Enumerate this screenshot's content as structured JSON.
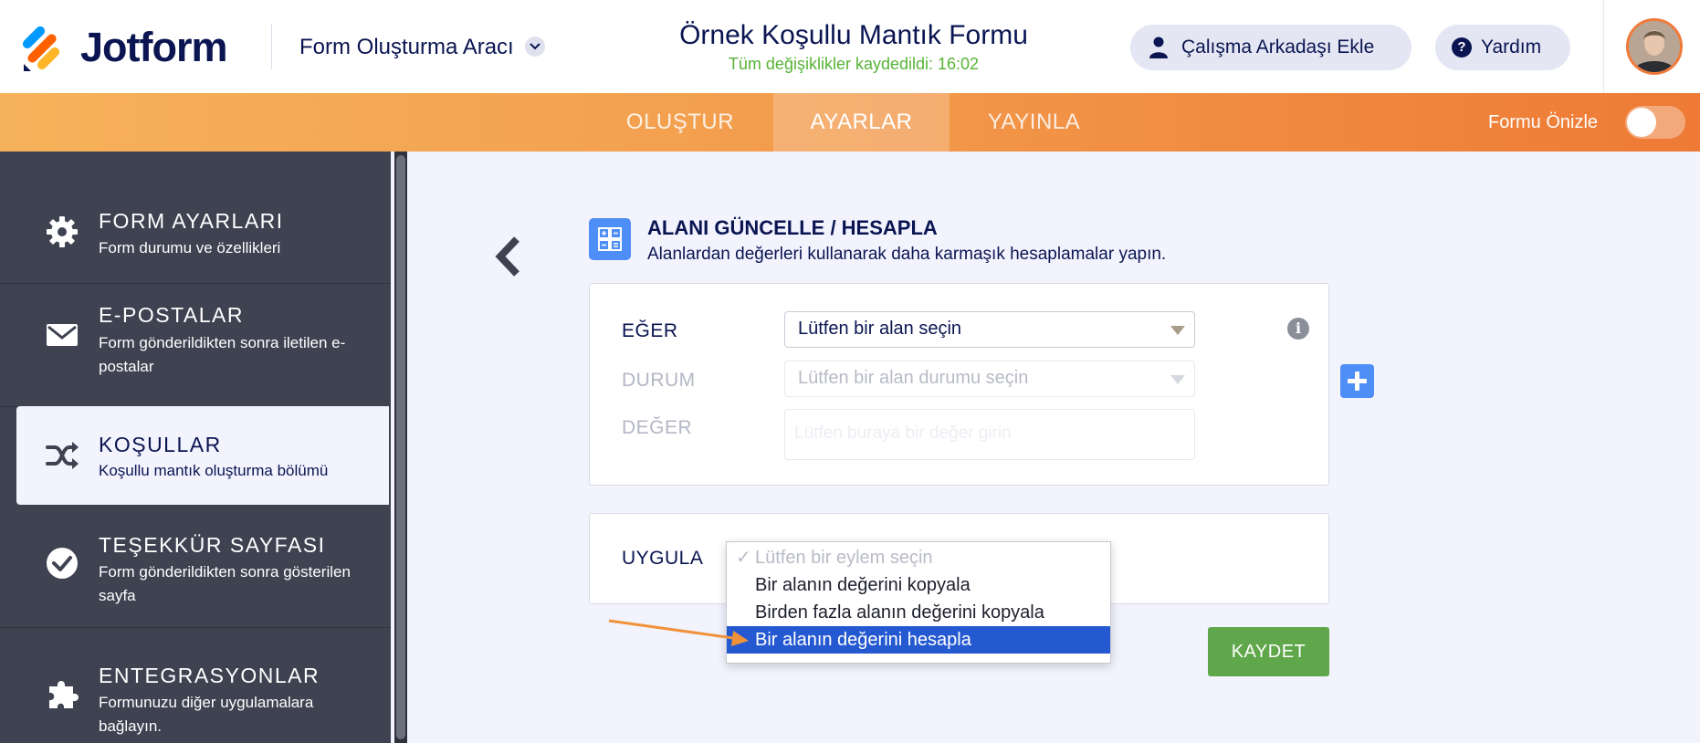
{
  "header": {
    "logo_text": "Jotform",
    "builder_label": "Form Oluşturma Aracı",
    "form_title": "Örnek Koşullu Mantık Formu",
    "saved_status": "Tüm değişiklikler kaydedildi: 16:02",
    "collab_button": "Çalışma Arkadaşı Ekle",
    "help_button": "Yardım",
    "colors": {
      "brand_navy": "#0a1551",
      "saved_green": "#58b336",
      "avatar_ring": "#f07a3a"
    }
  },
  "nav": {
    "tabs": [
      {
        "label": "OLUŞTUR",
        "active": false
      },
      {
        "label": "AYARLAR",
        "active": true
      },
      {
        "label": "YAYINLA",
        "active": false
      }
    ],
    "preview_label": "Formu Önizle",
    "preview_toggle": "off"
  },
  "sidebar": {
    "items": [
      {
        "title": "FORM AYARLARI",
        "subtitle": "Form durumu ve özellikleri",
        "icon": "gear-icon"
      },
      {
        "title": "E-POSTALAR",
        "subtitle": "Form gönderildikten sonra iletilen e-postalar",
        "icon": "envelope-icon"
      },
      {
        "title": "KOŞULLAR",
        "subtitle": "Koşullu mantık oluşturma bölümü",
        "icon": "shuffle-icon",
        "active": true
      },
      {
        "title": "TEŞEKKÜR SAYFASI",
        "subtitle": "Form gönderildikten sonra gösterilen sayfa",
        "icon": "check-circle-icon"
      },
      {
        "title": "ENTEGRASYONLAR",
        "subtitle": "Formunuzu diğer uygulamalara bağlayın.",
        "icon": "puzzle-icon"
      }
    ]
  },
  "condition": {
    "title": "ALANI GÜNCELLE / HESAPLA",
    "subtitle": "Alanlardan değerleri kullanarak daha karmaşık hesaplamalar yapın.",
    "if_label": "EĞER",
    "if_value": "Lütfen bir alan seçin",
    "state_label": "DURUM",
    "state_placeholder": "Lütfen bir alan durumu seçin",
    "value_label": "DEĞER",
    "value_placeholder": "Lütfen buraya bir değer girin",
    "do_label": "UYGULA",
    "dropdown_options": [
      {
        "label": "Lütfen bir eylem seçin",
        "placeholder": true,
        "checked": true
      },
      {
        "label": "Bir alanın değerini kopyala"
      },
      {
        "label": "Birden fazla alanın değerini kopyala"
      },
      {
        "label": "Bir alanın değerini hesapla",
        "highlighted": true
      }
    ],
    "save_button": "KAYDET",
    "colors": {
      "save_green": "#5fa74a",
      "highlight_blue": "#2559d1",
      "accent_blue": "#4e8ef7",
      "arrow_orange": "#f0923a"
    }
  }
}
